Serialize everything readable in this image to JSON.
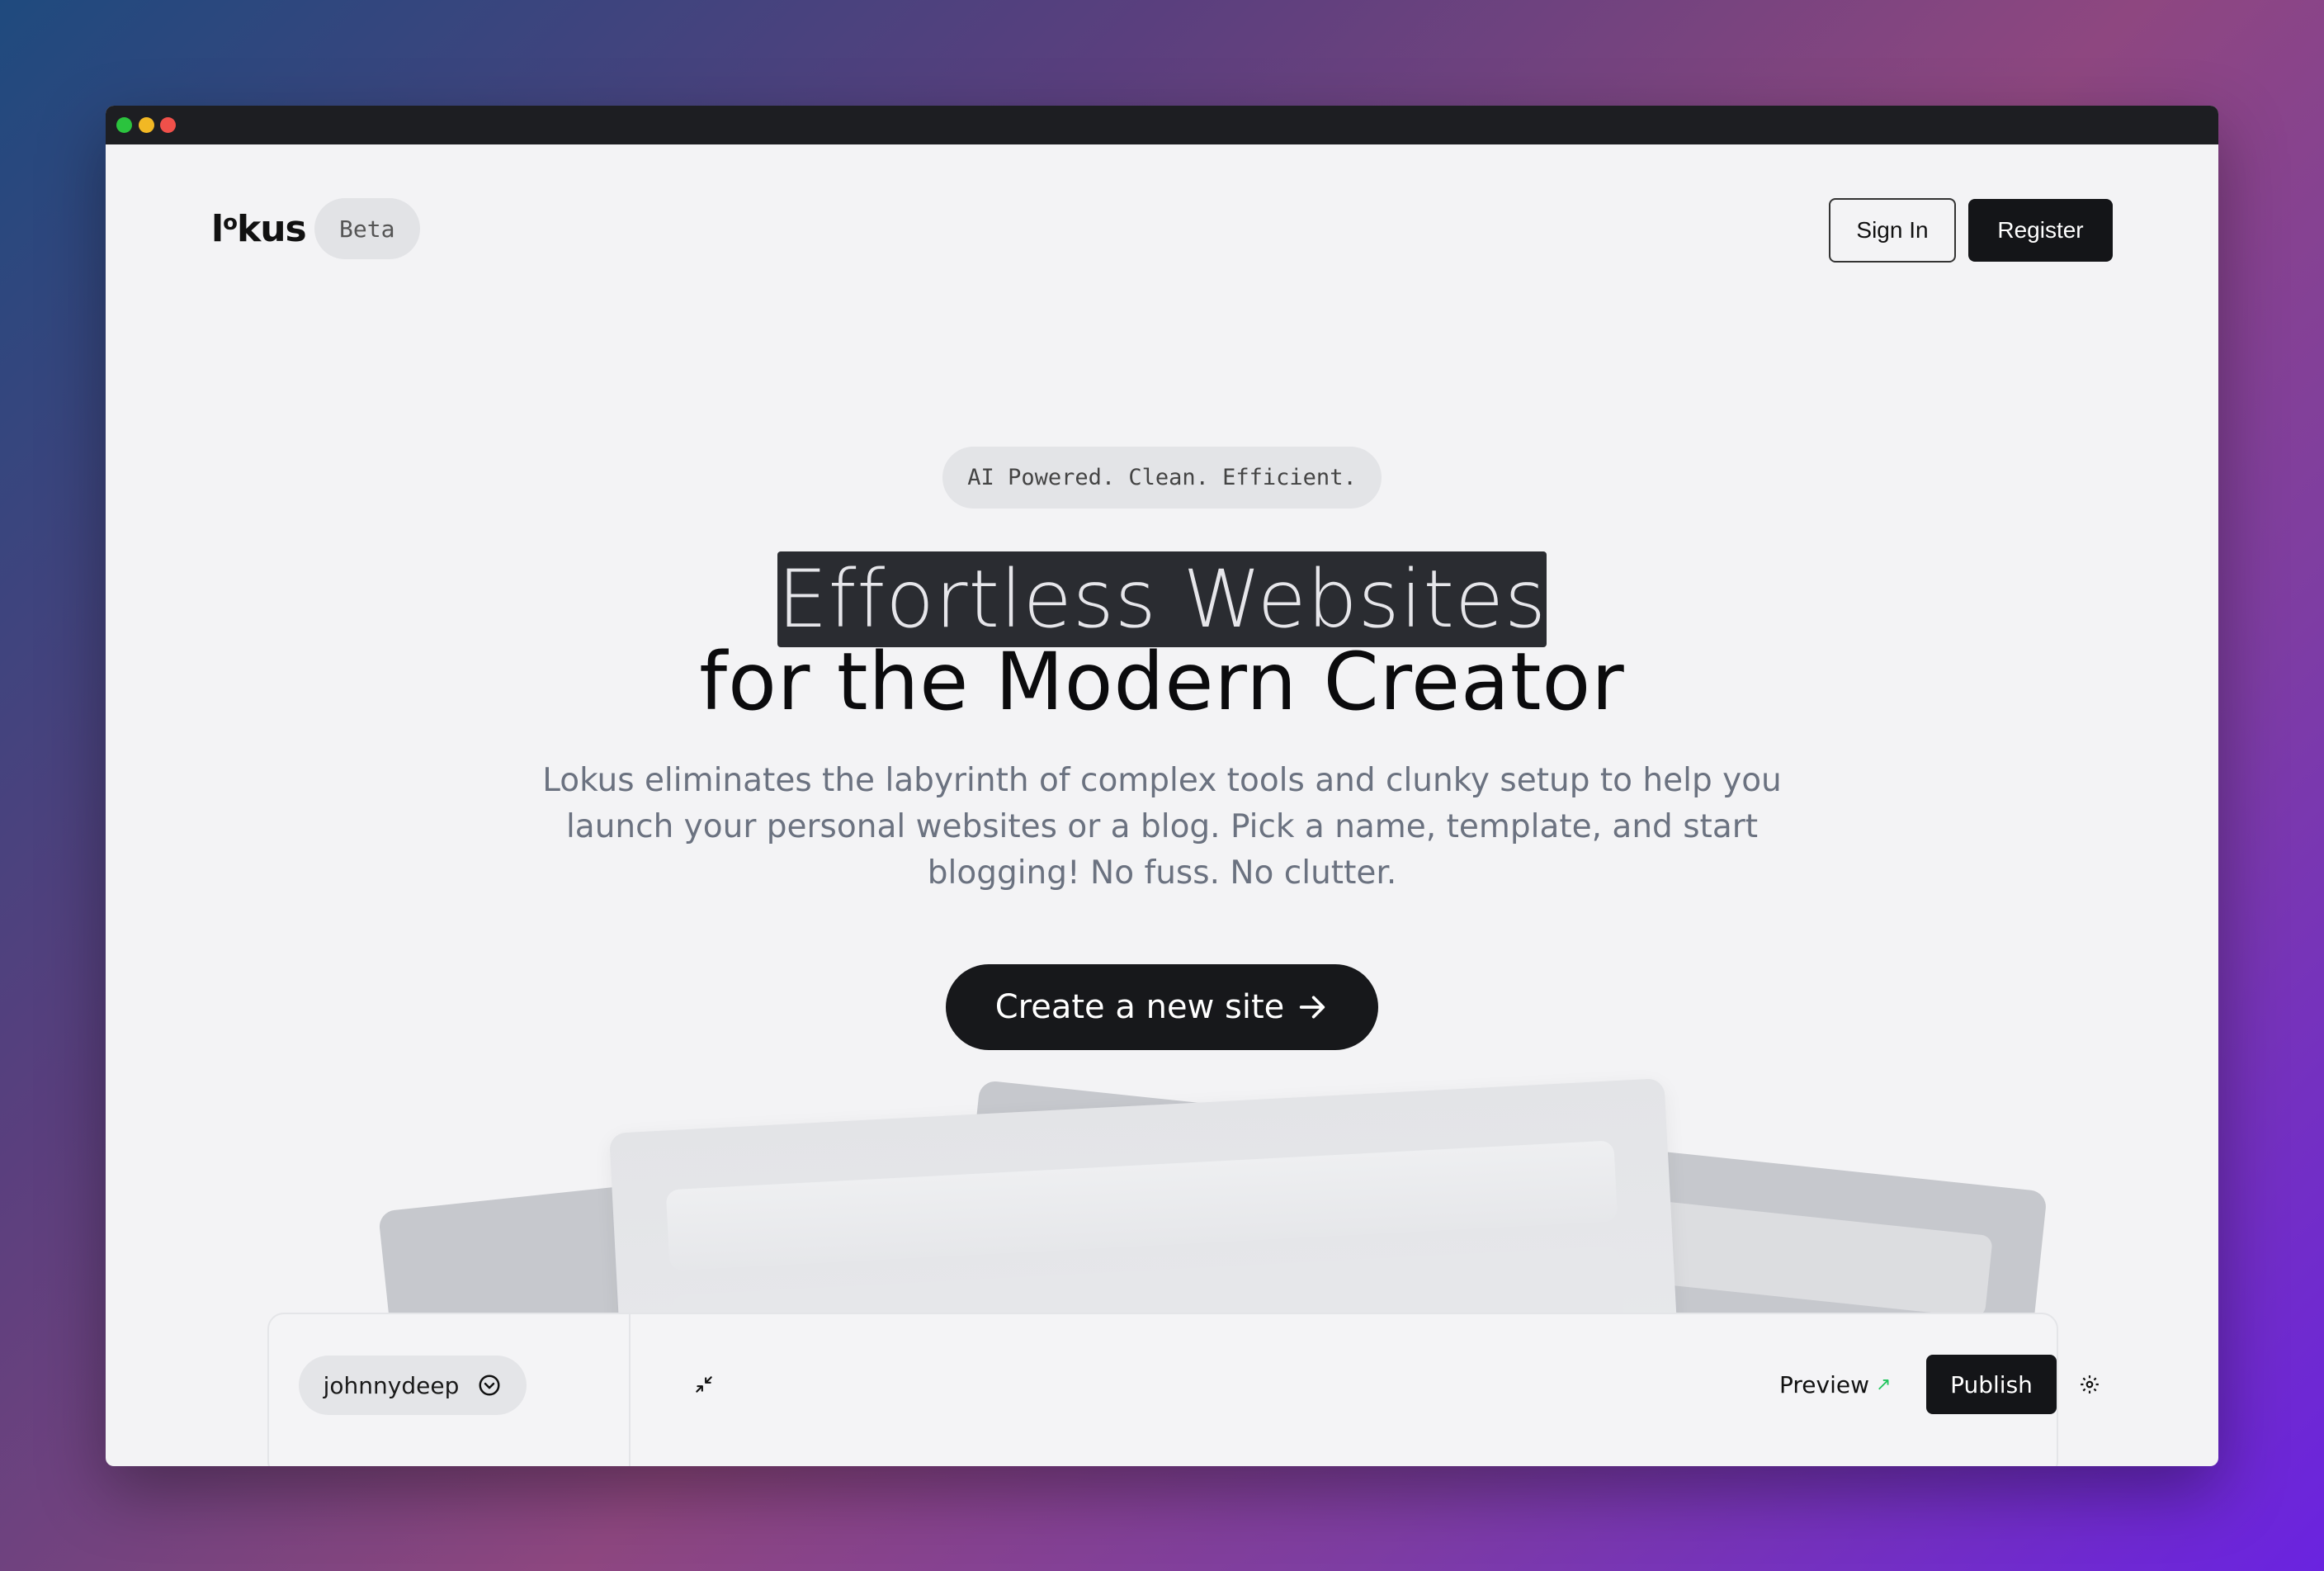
{
  "window": {
    "controls": [
      "green",
      "yellow",
      "red"
    ]
  },
  "header": {
    "logo_main": "l",
    "logo_sup": "o",
    "logo_rest": "kus",
    "badge": "Beta",
    "signin_label": "Sign In",
    "register_label": "Register"
  },
  "hero": {
    "tagline": "AI Powered. Clean. Efficient.",
    "headline_line1": "Effortless Websites",
    "headline_line2": "for the Modern Creator",
    "subtitle": "Lokus eliminates the labyrinth of complex tools and clunky setup to help you launch your personal websites or a blog. Pick a name, template, and start blogging! No fuss. No clutter.",
    "cta_label": "Create a new site"
  },
  "editor": {
    "username": "johnnydeep",
    "preview_label": "Preview",
    "publish_label": "Publish",
    "icons": [
      "chevron-down-circle-icon",
      "collapse-icon",
      "external-arrow-icon",
      "gear-icon"
    ]
  },
  "colors": {
    "dark": "#141518",
    "accent_green": "#22c55e",
    "page_bg": "#f3f3f5"
  }
}
